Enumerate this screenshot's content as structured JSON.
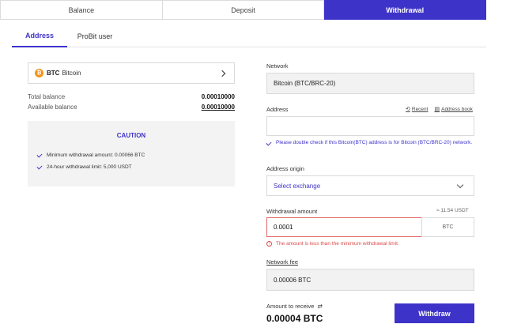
{
  "top_tabs": [
    {
      "label": "Balance"
    },
    {
      "label": "Deposit"
    },
    {
      "label": "Withdrawal"
    }
  ],
  "sub_tabs": [
    {
      "label": "Address"
    },
    {
      "label": "ProBit user"
    }
  ],
  "asset": {
    "icon_glyph": "₿",
    "symbol": "BTC",
    "name": "Bitcoin"
  },
  "balances": {
    "total_label": "Total balance",
    "total_value": "0.00010000",
    "available_label": "Available balance",
    "available_value": "0.00010000"
  },
  "caution": {
    "title": "CAUTION",
    "items": [
      "Minimum withdrawal amount: 0.00066 BTC",
      "24-hour withdrawal limit: 5,000 USDT"
    ]
  },
  "network": {
    "label": "Network",
    "value": "Bitcoin (BTC/BRC-20)"
  },
  "address": {
    "label": "Address",
    "recent_label": "Recent",
    "book_label": "Address book",
    "value": "",
    "notice": "Please double check if this Bitcoin(BTC) address is for Bitcoin (BTC/BRC-20) network."
  },
  "address_origin": {
    "label": "Address origin",
    "selected": "Select exchange"
  },
  "amount": {
    "label": "Withdrawal amount",
    "approx": "≈ 11.54 USDT",
    "value": "0.0001",
    "unit": "BTC",
    "error": "The amount is less than the minimum withdrawal limit."
  },
  "fee": {
    "label": "Network fee",
    "value": "0.00006 BTC"
  },
  "receive": {
    "label": "Amount to receive",
    "value": "0.00004 BTC"
  },
  "withdraw_button": "Withdraw",
  "colors": {
    "accent": "#3e33c9",
    "error": "#d94a4a",
    "coin": "#f7931a"
  }
}
